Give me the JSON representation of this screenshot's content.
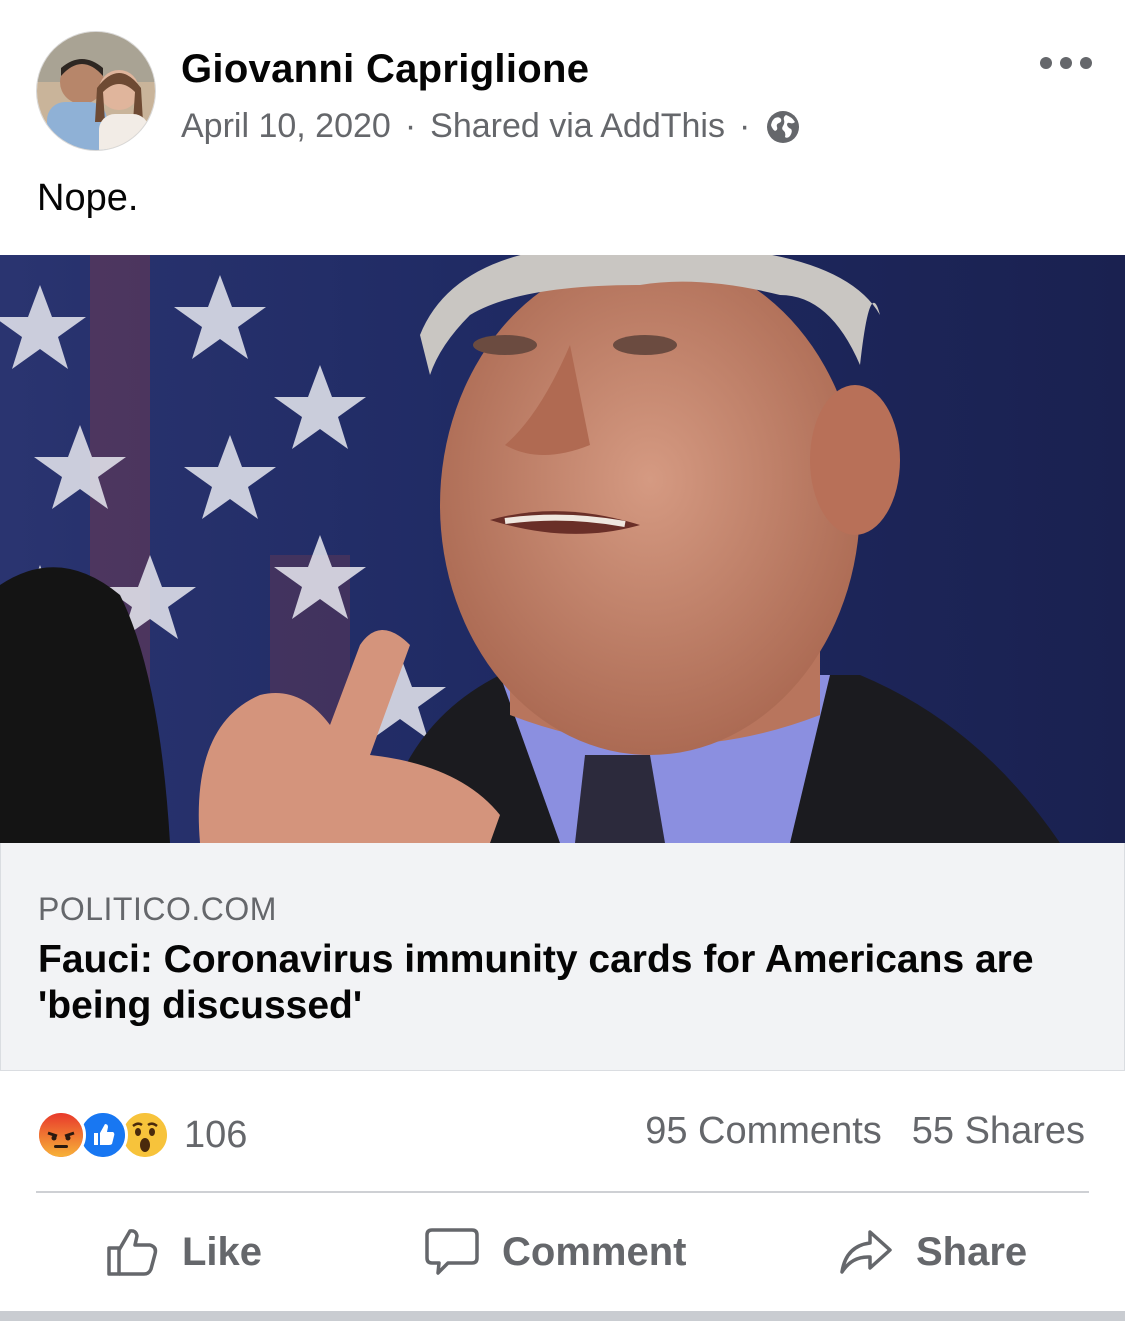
{
  "post": {
    "author": "Giovanni Capriglione",
    "date": "April 10, 2020",
    "separator": "·",
    "shared_via": "Shared via AddThis",
    "privacy_icon": "globe-icon",
    "text": "Nope."
  },
  "link": {
    "domain": "POLITICO.COM",
    "headline": "Fauci: Coronavirus immunity cards for Americans are 'being discussed'"
  },
  "stats": {
    "reaction_icons": [
      "angry-reaction-icon",
      "like-reaction-icon",
      "wow-reaction-icon"
    ],
    "reaction_count": "106",
    "comments": "95 Comments",
    "shares": "55 Shares"
  },
  "actions": {
    "like": "Like",
    "comment": "Comment",
    "share": "Share"
  },
  "colors": {
    "text_primary": "#050505",
    "text_secondary": "#65676b",
    "like_blue": "#1877f2",
    "angry_orange": "#f0572a",
    "wow_yellow": "#f7c33b"
  }
}
